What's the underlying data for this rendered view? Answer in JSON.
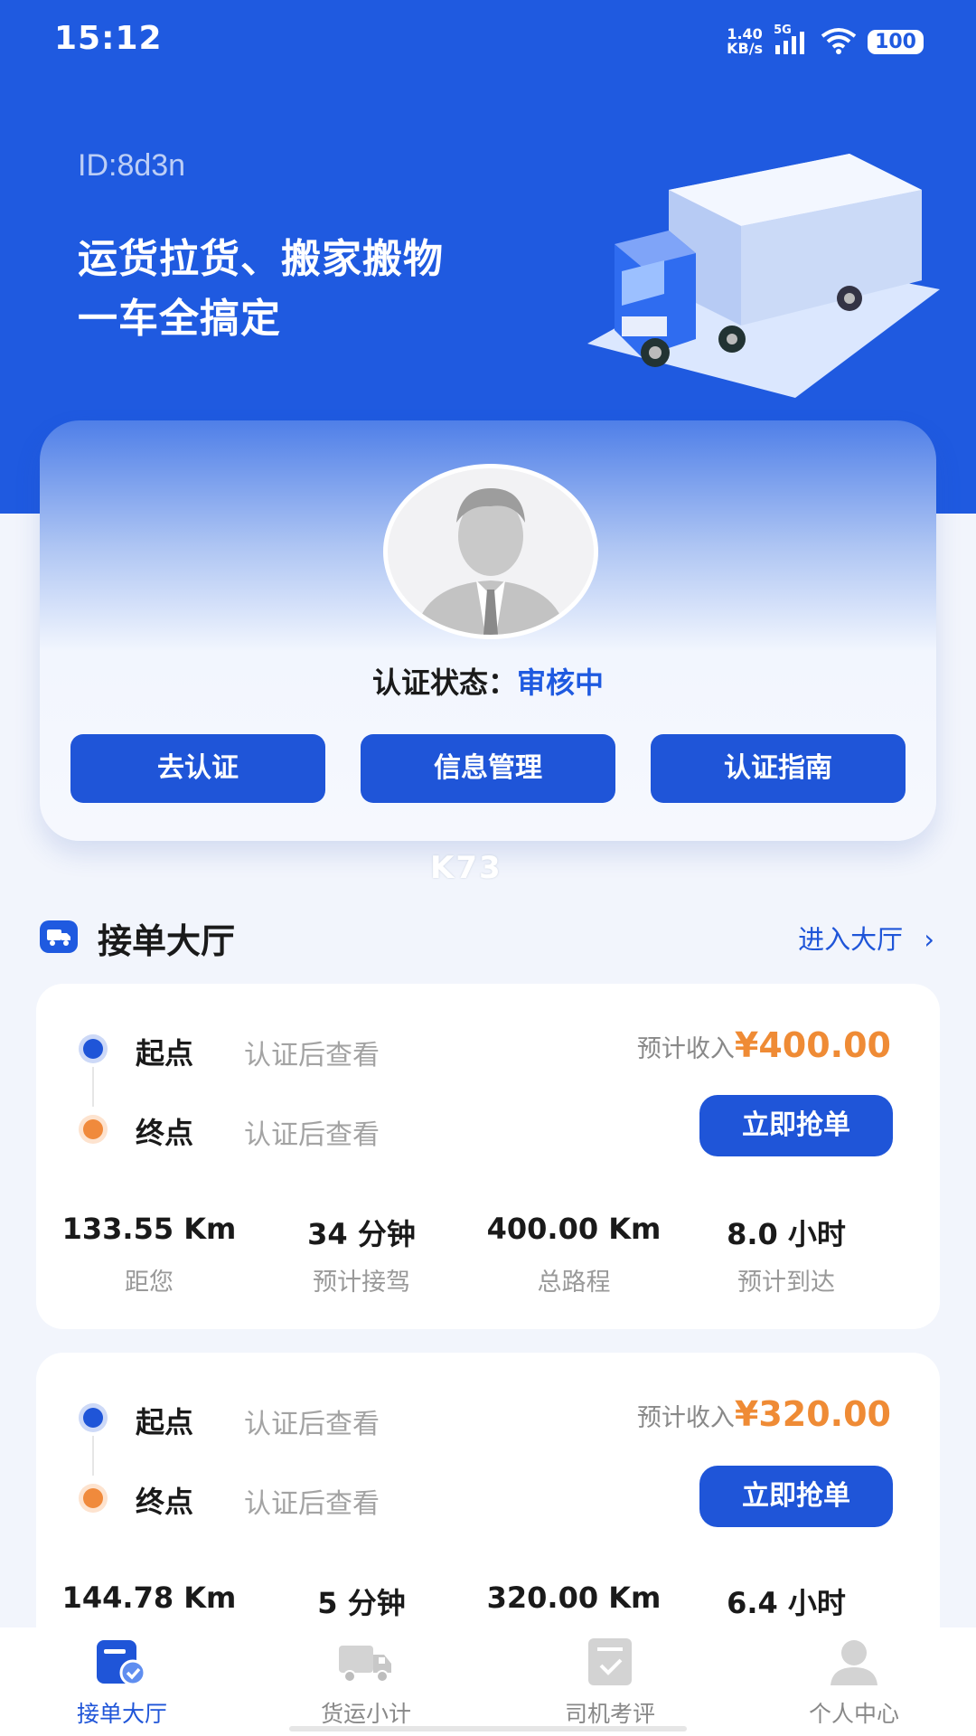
{
  "status_bar": {
    "time": "15:12",
    "net_speed_value": "1.40",
    "net_speed_unit": "KB/s",
    "network": "5G",
    "battery": "100"
  },
  "hero": {
    "id_text": "ID:8d3n",
    "title_line1": "运货拉货、搬家搬物",
    "title_line2": "一车全搞定"
  },
  "profile": {
    "cert_label": "认证状态：",
    "cert_status": "审核中",
    "buttons": [
      "去认证",
      "信息管理",
      "认证指南"
    ]
  },
  "watermark": "K73",
  "section": {
    "title": "接单大厅",
    "link": "进入大厅",
    "link_icon": "chevron-right-icon"
  },
  "orders": [
    {
      "start_label": "起点",
      "start_value": "认证后查看",
      "end_label": "终点",
      "end_value": "认证后查看",
      "income_label": "预计收入",
      "income_amount": "¥400.00",
      "grab_label": "立即抢单",
      "stats": [
        {
          "value": "133.55 Km",
          "label": "距您"
        },
        {
          "value": "34 分钟",
          "label": "预计接驾"
        },
        {
          "value": "400.00 Km",
          "label": "总路程"
        },
        {
          "value": "8.0 小时",
          "label": "预计到达"
        }
      ]
    },
    {
      "start_label": "起点",
      "start_value": "认证后查看",
      "end_label": "终点",
      "end_value": "认证后查看",
      "income_label": "预计收入",
      "income_amount": "¥320.00",
      "grab_label": "立即抢单",
      "stats": [
        {
          "value": "144.78 Km",
          "label": ""
        },
        {
          "value": "5 分钟",
          "label": ""
        },
        {
          "value": "320.00 Km",
          "label": ""
        },
        {
          "value": "6.4 小时",
          "label": ""
        }
      ]
    }
  ],
  "tabbar": [
    {
      "label": "接单大厅",
      "icon": "order-hall-icon",
      "active": true
    },
    {
      "label": "货运小计",
      "icon": "truck-icon",
      "active": false
    },
    {
      "label": "司机考评",
      "icon": "review-icon",
      "active": false
    },
    {
      "label": "个人中心",
      "icon": "person-icon",
      "active": false
    }
  ],
  "colors": {
    "brand_blue": "#1f5ae0",
    "accent_orange": "#ef8b35"
  }
}
